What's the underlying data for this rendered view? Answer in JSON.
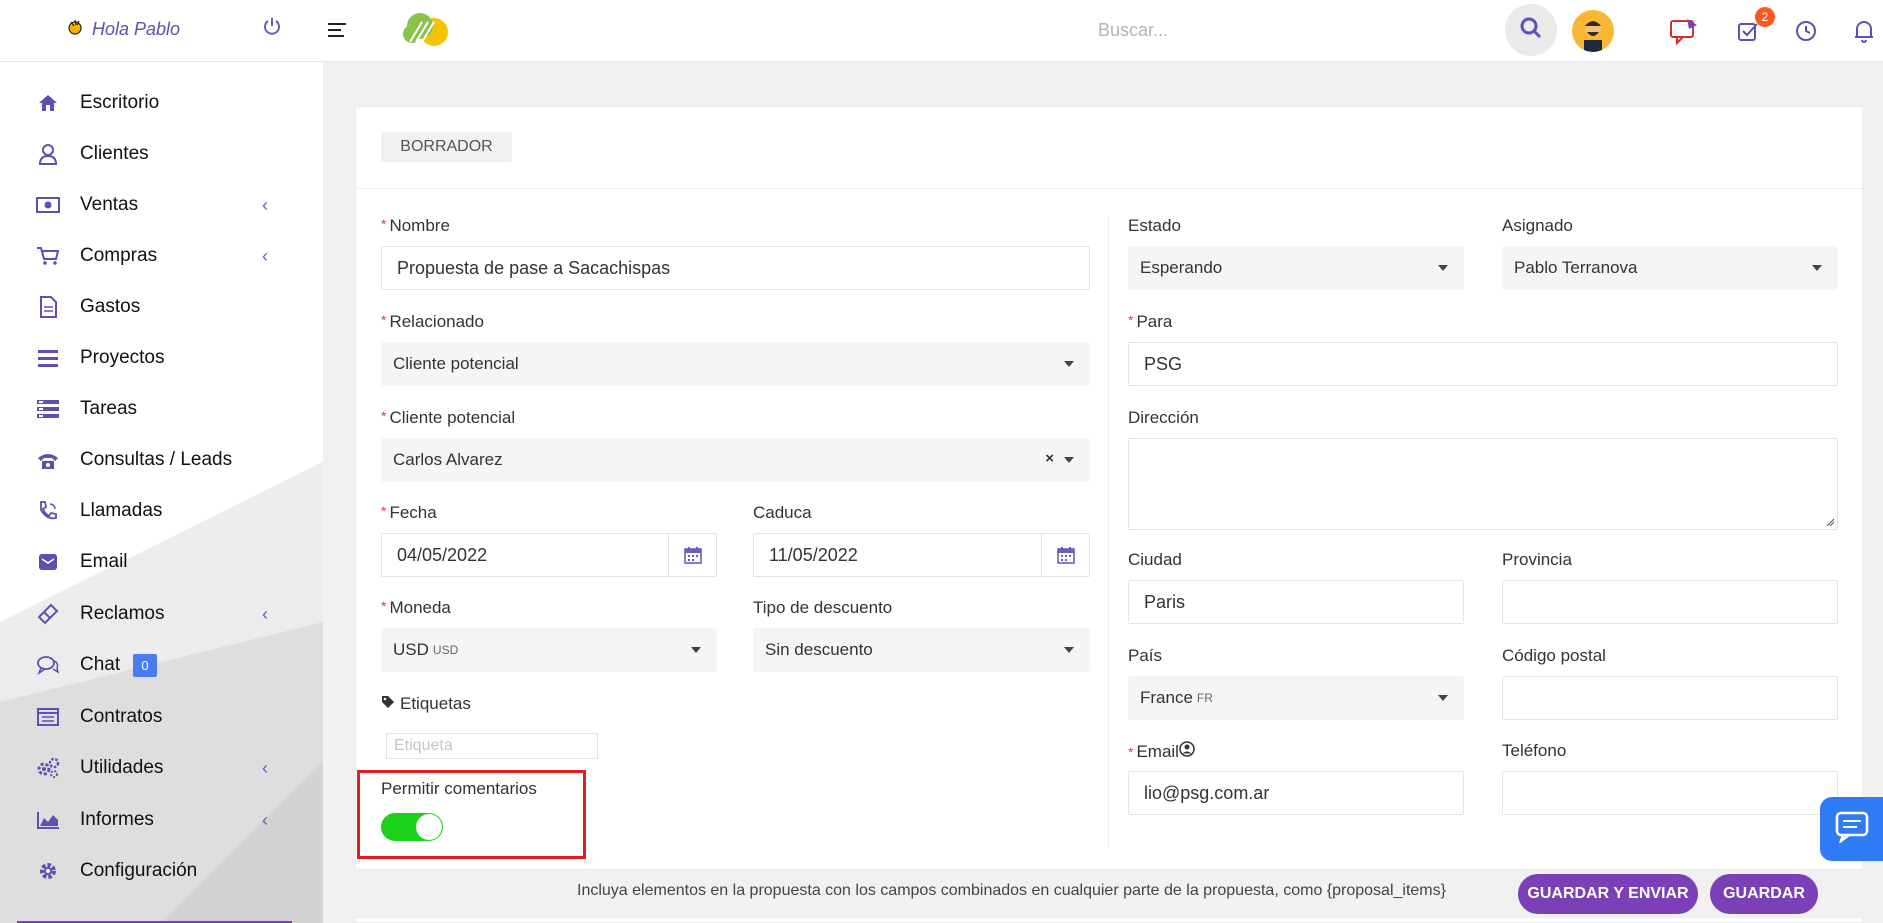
{
  "header": {
    "greeting": "Hola Pablo",
    "search_placeholder": "Buscar...",
    "tasks_badge": "2"
  },
  "sidebar": {
    "items": [
      {
        "label": "Escritorio",
        "icon": "home-icon"
      },
      {
        "label": "Clientes",
        "icon": "user-icon"
      },
      {
        "label": "Ventas",
        "icon": "money-icon"
      },
      {
        "label": "Compras",
        "icon": "cart-icon"
      },
      {
        "label": "Gastos",
        "icon": "document-icon"
      },
      {
        "label": "Proyectos",
        "icon": "bars-icon"
      },
      {
        "label": "Tareas",
        "icon": "tasks-icon"
      },
      {
        "label": "Consultas / Leads",
        "icon": "phone-icon"
      },
      {
        "label": "Llamadas",
        "icon": "call-icon"
      },
      {
        "label": "Email",
        "icon": "envelope-icon"
      },
      {
        "label": "Reclamos",
        "icon": "ticket-icon"
      },
      {
        "label": "Chat",
        "icon": "chat-icon"
      },
      {
        "label": "Contratos",
        "icon": "contract-icon"
      },
      {
        "label": "Utilidades",
        "icon": "cogs-icon"
      },
      {
        "label": "Informes",
        "icon": "chart-area-icon"
      },
      {
        "label": "Configuración",
        "icon": "gear-icon"
      }
    ],
    "chat_count": "0"
  },
  "proposal": {
    "status": "BORRADOR",
    "nombre_label": "Nombre",
    "nombre_value": "Propuesta de pase a Sacachispas",
    "relacionado_label": "Relacionado",
    "relacionado_value": "Cliente potencial",
    "cliente_label": "Cliente potencial",
    "cliente_value": "Carlos Alvarez",
    "fecha_label": "Fecha",
    "fecha_value": "04/05/2022",
    "caduca_label": "Caduca",
    "caduca_value": "11/05/2022",
    "moneda_label": "Moneda",
    "moneda_value": "USD",
    "moneda_code": "USD",
    "descuento_label": "Tipo de descuento",
    "descuento_value": "Sin descuento",
    "etiquetas_label": "Etiquetas",
    "etiqueta_placeholder": "Etiqueta",
    "comentarios_label": "Permitir comentarios",
    "comentarios_enabled": true,
    "estado_label": "Estado",
    "estado_value": "Esperando",
    "asignado_label": "Asignado",
    "asignado_value": "Pablo Terranova",
    "para_label": "Para",
    "para_value": "PSG",
    "direccion_label": "Dirección",
    "direccion_value": "",
    "ciudad_label": "Ciudad",
    "ciudad_value": "Paris",
    "provincia_label": "Provincia",
    "provincia_value": "",
    "pais_label": "País",
    "pais_value": "France",
    "pais_code": "FR",
    "codigo_postal_label": "Código postal",
    "codigo_postal_value": "",
    "email_label": "Email",
    "email_value": "lio@psg.com.ar",
    "telefono_label": "Teléfono",
    "telefono_value": ""
  },
  "footer": {
    "hint": "Incluya elementos en la propuesta con los campos combinados en cualquier parte de la propuesta, como {proposal_items}",
    "save_send_label": "GUARDAR Y ENVIAR",
    "save_label": "GUARDAR"
  },
  "colors": {
    "accent": "#5e4fb3",
    "button": "#7b3fb8",
    "toggle_on": "#1ad21a",
    "required": "#e53935",
    "highlight_border": "#e41e1e",
    "badge": "#ff5722"
  }
}
